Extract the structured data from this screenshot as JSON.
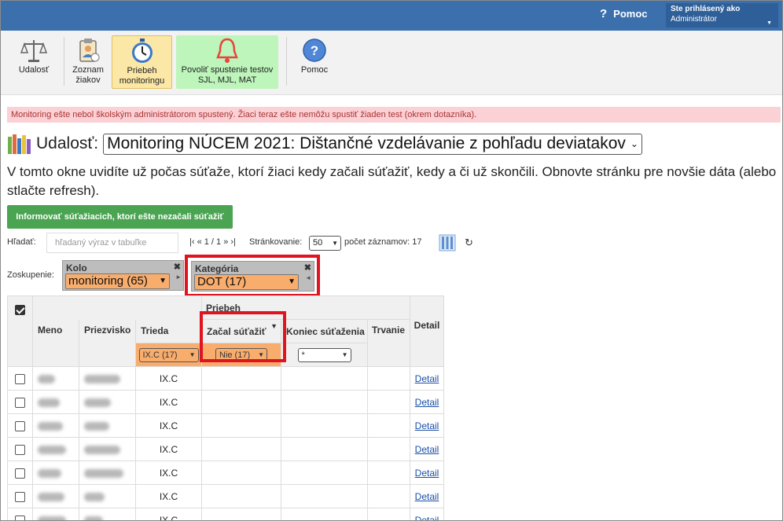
{
  "header": {
    "help_label": "Pomoc",
    "user_line1": "Ste prihlásený ako",
    "user_line2": "Administrátor"
  },
  "toolbar": {
    "items": [
      {
        "label": "Udalosť",
        "icon": "scales-icon"
      },
      {
        "label": "Zoznam žiakov",
        "icon": "clipboard-icon"
      },
      {
        "label": "Priebeh monitoringu",
        "icon": "stopwatch-icon"
      },
      {
        "label": "Povoliť spustenie testov SJL, MJL, MAT",
        "icon": "bell-icon"
      },
      {
        "label": "Pomoc",
        "icon": "help-circle-icon"
      }
    ]
  },
  "alert": "Monitoring ešte nebol školským administrátorom spustený. Žiaci teraz ešte nemôžu spustiť žiaden test (okrem dotazníka).",
  "event": {
    "label": "Udalosť:",
    "selected": "Monitoring NÚCEM 2021: Dištančné vzdelávanie z pohľadu deviatakov"
  },
  "info_text": "V tomto okne uvidíte už počas súťaže, ktorí žiaci kedy začali súťažiť, kedy a či už skončili. Obnovte stránku pre novšie dáta (alebo stlačte refresh).",
  "notify_button": "Informovať súťažiacich, ktorí ešte nezačali súťažiť",
  "search": {
    "label": "Hľadať:",
    "placeholder": "hľadaný výraz v tabuľke"
  },
  "pager": {
    "text": "|‹ « 1 / 1 » ›|",
    "paging_label": "Stránkovanie:",
    "page_size": "50",
    "count_label": "počet záznamov: 17"
  },
  "grouping": {
    "label": "Zoskupenie:",
    "groups": [
      {
        "title": "Kolo",
        "value": "monitoring (65)"
      },
      {
        "title": "Kategória",
        "value": "DOT (17)"
      }
    ]
  },
  "table": {
    "group_header": "Priebeh",
    "columns": [
      "Meno",
      "Priezvisko",
      "Trieda",
      "Začal súťažiť",
      "Koniec súťaženia",
      "Trvanie",
      "Detail"
    ],
    "filters": {
      "trieda": "IX.C (17)",
      "zacal": "Nie (17)",
      "koniec": "*"
    },
    "rows": [
      {
        "trieda": "IX.C",
        "detail": "Detail"
      },
      {
        "trieda": "IX.C",
        "detail": "Detail"
      },
      {
        "trieda": "IX.C",
        "detail": "Detail"
      },
      {
        "trieda": "IX.C",
        "detail": "Detail"
      },
      {
        "trieda": "IX.C",
        "detail": "Detail"
      },
      {
        "trieda": "IX.C",
        "detail": "Detail"
      },
      {
        "trieda": "IX.C",
        "detail": "Detail"
      }
    ]
  },
  "colors": {
    "topbar": "#3b70ad",
    "alert_bg": "#fbd1d5",
    "notify_btn": "#4aa452",
    "filter_highlight": "#f9ad6c",
    "red_outline": "#e0141e"
  }
}
